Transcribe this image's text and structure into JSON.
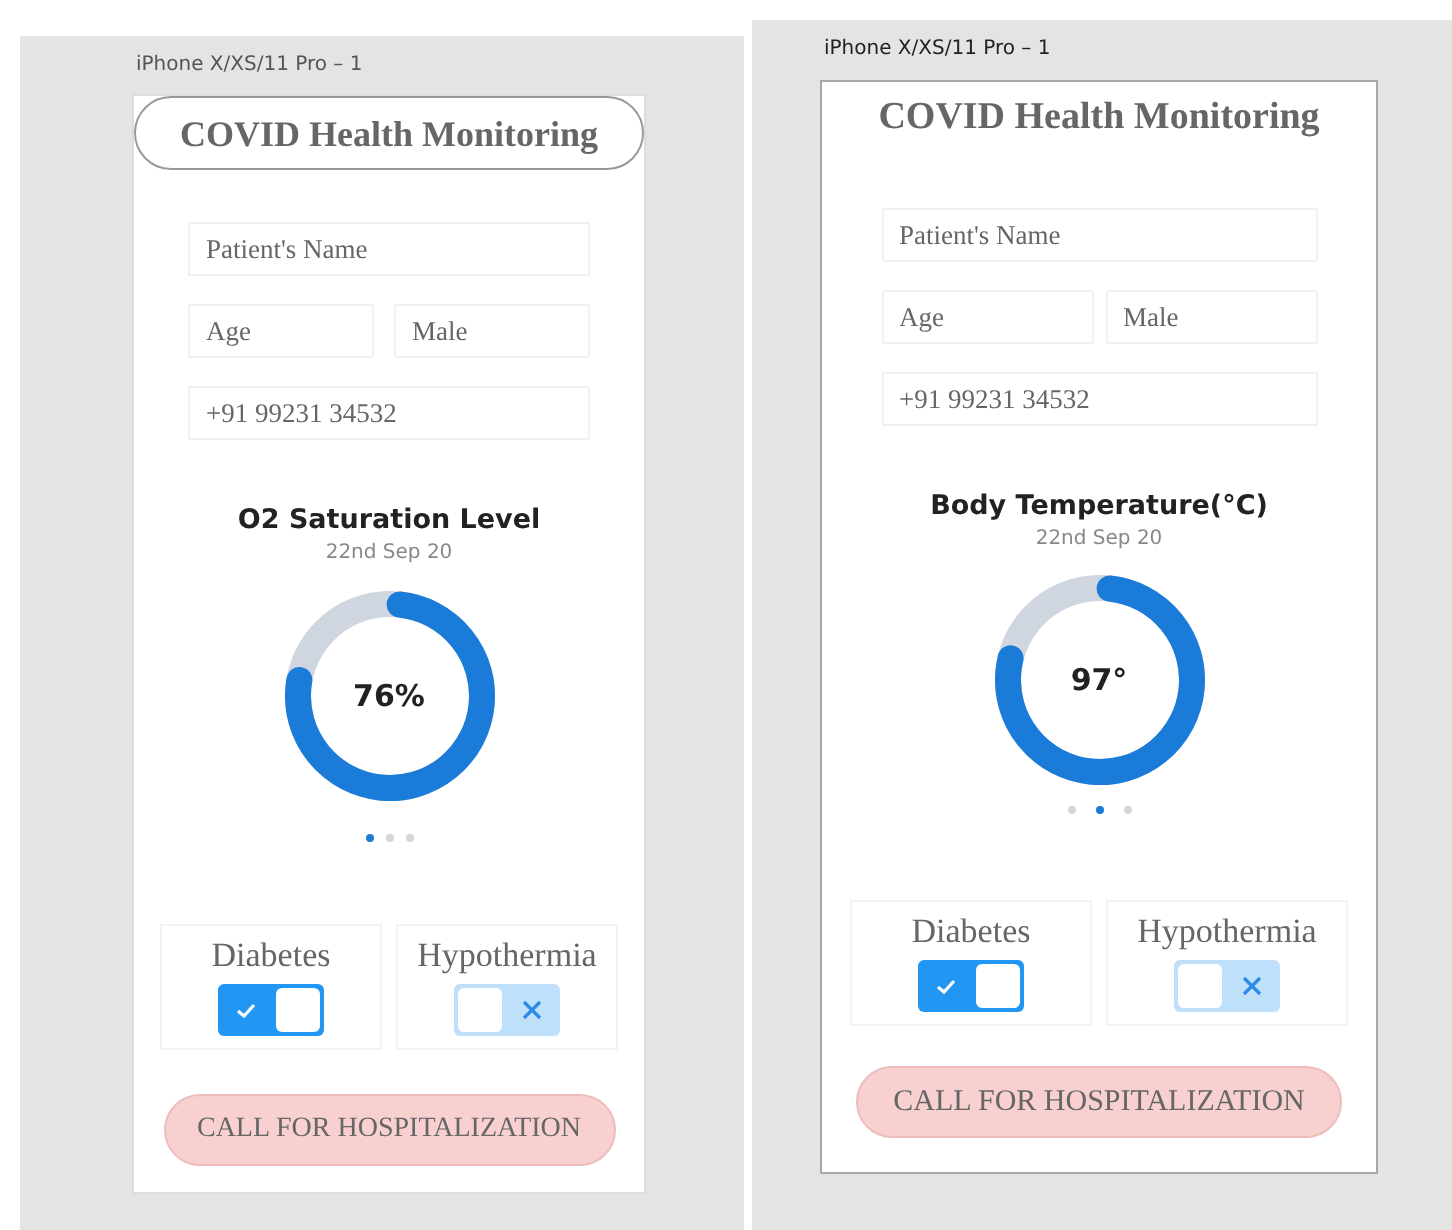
{
  "artboards": [
    {
      "label": "iPhone X/XS/11 Pro – 1",
      "title": "COVID Health Monitoring",
      "title_outlined": true,
      "fields": [
        {
          "kind": "wide",
          "placeholder": "Patient's Name"
        },
        {
          "kind": "half",
          "placeholder": "Age"
        },
        {
          "kind": "half",
          "value": "Male"
        },
        {
          "kind": "wide",
          "value": "+91 99231 34532"
        }
      ],
      "metric": {
        "title": "O2 Saturation Level",
        "date": "22nd Sep 20",
        "reading": "76%",
        "level": 0.76
      },
      "pages": [
        {
          "selected": true
        },
        {
          "selected": false
        },
        {
          "selected": false
        }
      ],
      "toggles": [
        {
          "label": "Diabetes",
          "on": true
        },
        {
          "label": "Hypothermia",
          "on": false
        }
      ],
      "button": "CALL FOR HOSPITALIZATION"
    },
    {
      "label": "iPhone X/XS/11 Pro – 1",
      "title": "COVID Health Monitoring",
      "title_outlined": false,
      "fields": [
        {
          "kind": "wide",
          "placeholder": "Patient's Name"
        },
        {
          "kind": "half",
          "placeholder": "Age"
        },
        {
          "kind": "half",
          "value": "Male"
        },
        {
          "kind": "wide",
          "value": "+91 99231 34532"
        }
      ],
      "metric": {
        "title": "Body Temperature(°C)",
        "date": "22nd Sep 20",
        "reading": "97°",
        "level": 0.77
      },
      "pages": [
        {
          "selected": false
        },
        {
          "selected": true
        },
        {
          "selected": false
        }
      ],
      "toggles": [
        {
          "label": "Diabetes",
          "on": true
        },
        {
          "label": "Hypothermia",
          "on": false
        }
      ],
      "button": "CALL FOR HOSPITALIZATION"
    }
  ]
}
